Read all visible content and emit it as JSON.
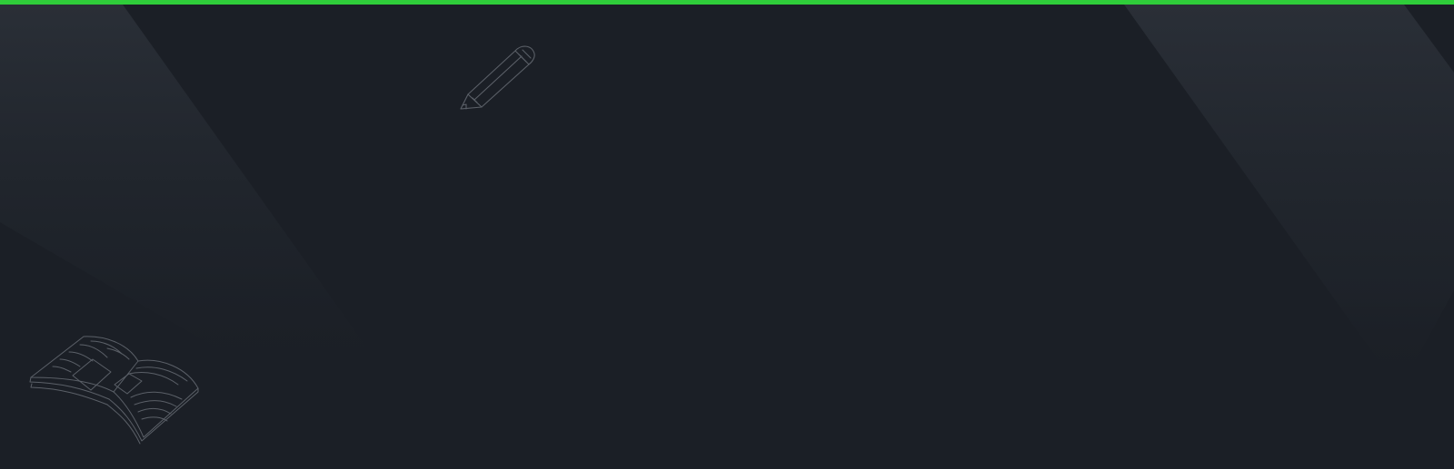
{
  "theme": {
    "background": "#1b1f26",
    "accent": "#2fcd3a",
    "light_beam": "#2b3039",
    "doodle_stroke": "#5b6068"
  },
  "decorations": [
    {
      "icon": "pencil-icon"
    },
    {
      "icon": "open-book-icon"
    }
  ]
}
